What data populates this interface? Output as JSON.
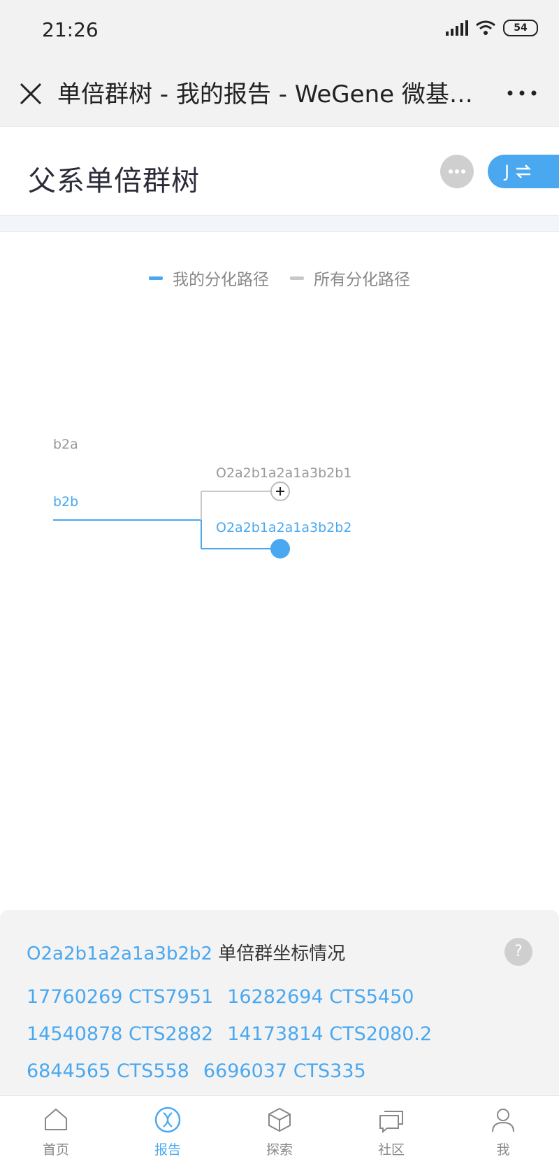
{
  "status_bar": {
    "time": "21:26",
    "battery": "54"
  },
  "nav": {
    "title": "单倍群树 - 我的报告 - WeGene 微基…"
  },
  "header": {
    "title": "父系单倍群树",
    "switch_label": "J"
  },
  "legend": {
    "mine": {
      "label": "我的分化路径",
      "color": "#4aa8f0"
    },
    "all": {
      "label": "所有分化路径",
      "color": "#c8c8c8"
    }
  },
  "tree": {
    "nodes": {
      "b2a": "b2a",
      "b2b": "b2b",
      "leaf1": "O2a2b1a2a1a3b2b1",
      "leaf2": "O2a2b1a2a1a3b2b2"
    }
  },
  "panel": {
    "haplogroup": "O2a2b1a2a1a3b2b2",
    "title_suffix": " 单倍群坐标情况",
    "help": "?",
    "markers": [
      [
        "17760269 CTS7951",
        "16282694 CTS5450"
      ],
      [
        "14540878 CTS2882",
        "14173814 CTS2080.2"
      ],
      [
        "6844565 CTS558",
        "6696037 CTS335"
      ]
    ]
  },
  "tabbar": {
    "items": [
      {
        "label": "首页",
        "icon": "home-icon"
      },
      {
        "label": "报告",
        "icon": "dna-icon",
        "active": true
      },
      {
        "label": "探索",
        "icon": "cube-icon"
      },
      {
        "label": "社区",
        "icon": "chat-icon"
      },
      {
        "label": "我",
        "icon": "user-icon"
      }
    ]
  },
  "colors": {
    "accent": "#4aa8f0",
    "gray_line": "#c8c8c8"
  }
}
